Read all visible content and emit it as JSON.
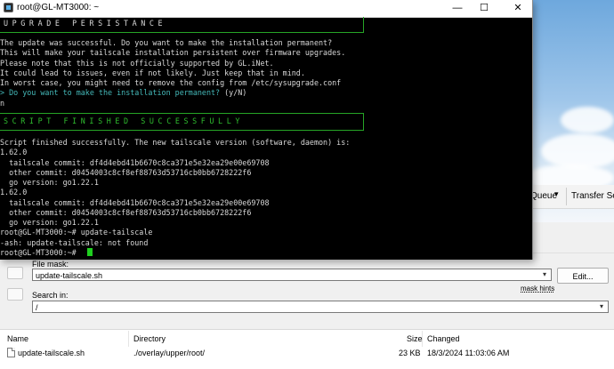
{
  "window": {
    "title": "root@GL-MT3000: ~",
    "minimize": "—",
    "maximize": "☐",
    "close": "✕"
  },
  "terminal": {
    "banner1": "UPGRADE PERSISTANCE",
    "lines_a": [
      "The update was successful. Do you want to make the installation permanent?",
      "This will make your tailscale installation persistent over firmware upgrades.",
      "Please note that this is not officially supported by GL.iNet.",
      "It could lead to issues, even if not likely. Just keep that in mind.",
      "In worst case, you might need to remove the config from /etc/sysupgrade.conf"
    ],
    "prompt_line": "> Do you want to make the installation permanent? (y/N)",
    "prompt_marker": "> ",
    "prompt_question": "Do you want to make the installation permanent?",
    "prompt_choice": " (y/N)",
    "answer": "n",
    "banner2": "SCRIPT FINISHED SUCCESSFULLY",
    "lines_b": [
      "Script finished successfully. The new tailscale version (software, daemon) is:",
      "1.62.0",
      "  tailscale commit: df4d4ebd41b6670c8ca371e5e32ea29e00e69708",
      "  other commit: d0454003c8cf8ef88763d53716cb0bb6728222f6",
      "  go version: go1.22.1",
      "1.62.0",
      "  tailscale commit: df4d4ebd41b6670c8ca371e5e32ea29e00e69708",
      "  other commit: d0454003c8cf8ef88763d53716cb0bb6728222f6",
      "  go version: go1.22.1",
      "root@GL-MT3000:~# update-tailscale",
      "-ash: update-tailscale: not found",
      "root@GL-MT3000:~# "
    ]
  },
  "background": {
    "queue_label": "Queue",
    "queue_arrow": "▾",
    "transfer_label": "Transfer Setti"
  },
  "search": {
    "file_mask_label": "File mask:",
    "file_mask_value": "update-tailscale.sh",
    "edit_button": "Edit...",
    "mask_hints": "mask hints",
    "search_in_label": "Search in:",
    "search_in_value": "/"
  },
  "results": {
    "columns": [
      "Name",
      "Directory",
      "Size",
      "Changed"
    ],
    "rows": [
      {
        "name": "update-tailscale.sh",
        "directory": "./overlay/upper/root/",
        "size": "23 KB",
        "changed": "18/3/2024 11:03:06 AM"
      }
    ]
  }
}
